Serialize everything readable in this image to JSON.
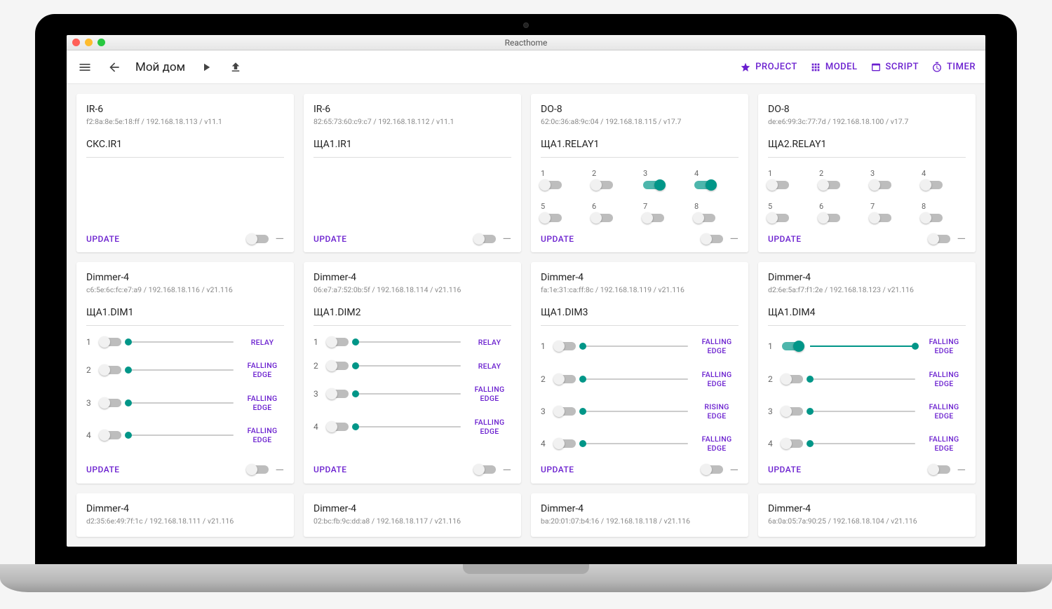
{
  "window": {
    "title": "Reacthome"
  },
  "header": {
    "title": "Мой дом",
    "tabs": [
      {
        "key": "project",
        "label": "PROJECT"
      },
      {
        "key": "model",
        "label": "MODEL"
      },
      {
        "key": "script",
        "label": "SCRIPT"
      },
      {
        "key": "timer",
        "label": "TIMER"
      }
    ]
  },
  "labels": {
    "update": "UPDATE"
  },
  "modes": {
    "relay": "RELAY",
    "falling": "FALLING EDGE",
    "rising": "RISING EDGE"
  },
  "cards": [
    {
      "type": "ir",
      "title": "IR-6",
      "sub": "f2:8a:8e:5e:18:ff / 192.168.18.113 / v11.1",
      "name": "СКС.IR1"
    },
    {
      "type": "ir",
      "title": "IR-6",
      "sub": "82:65:73:60:c9:c7 / 192.168.18.112 / v11.1",
      "name": "ЩА1.IR1"
    },
    {
      "type": "relay",
      "title": "DO-8",
      "sub": "62:0c:36:a8:9c:04 / 192.168.18.115 / v17.7",
      "name": "ЩА1.RELAY1",
      "channels": [
        {
          "n": "1",
          "on": false
        },
        {
          "n": "2",
          "on": false
        },
        {
          "n": "3",
          "on": true
        },
        {
          "n": "4",
          "on": true
        },
        {
          "n": "5",
          "on": false
        },
        {
          "n": "6",
          "on": false
        },
        {
          "n": "7",
          "on": false
        },
        {
          "n": "8",
          "on": false
        }
      ]
    },
    {
      "type": "relay",
      "title": "DO-8",
      "sub": "de:e6:99:3c:77:7d / 192.168.18.100 / v17.7",
      "name": "ЩА2.RELAY1",
      "channels": [
        {
          "n": "1",
          "on": false
        },
        {
          "n": "2",
          "on": false
        },
        {
          "n": "3",
          "on": false
        },
        {
          "n": "4",
          "on": false
        },
        {
          "n": "5",
          "on": false
        },
        {
          "n": "6",
          "on": false
        },
        {
          "n": "7",
          "on": false
        },
        {
          "n": "8",
          "on": false
        }
      ]
    },
    {
      "type": "dimmer",
      "title": "Dimmer-4",
      "sub": "c6:5e:6c:fc:e7:a9 / 192.168.18.116 / v21.116",
      "name": "ЩА1.DIM1",
      "channels": [
        {
          "n": "1",
          "on": false,
          "val": 0,
          "mode": "relay"
        },
        {
          "n": "2",
          "on": false,
          "val": 0,
          "mode": "falling"
        },
        {
          "n": "3",
          "on": false,
          "val": 0,
          "mode": "falling"
        },
        {
          "n": "4",
          "on": false,
          "val": 0,
          "mode": "falling"
        }
      ]
    },
    {
      "type": "dimmer",
      "title": "Dimmer-4",
      "sub": "06:e7:a7:52:0b:5f / 192.168.18.114 / v21.116",
      "name": "ЩА1.DIM2",
      "channels": [
        {
          "n": "1",
          "on": false,
          "val": 0,
          "mode": "relay"
        },
        {
          "n": "2",
          "on": false,
          "val": 0,
          "mode": "relay"
        },
        {
          "n": "3",
          "on": false,
          "val": 0,
          "mode": "falling"
        },
        {
          "n": "4",
          "on": false,
          "val": 0,
          "mode": "falling"
        }
      ]
    },
    {
      "type": "dimmer",
      "title": "Dimmer-4",
      "sub": "fa:1e:31:ca:ff:8c / 192.168.18.119 / v21.116",
      "name": "ЩА1.DIM3",
      "channels": [
        {
          "n": "1",
          "on": false,
          "val": 0,
          "mode": "falling"
        },
        {
          "n": "2",
          "on": false,
          "val": 0,
          "mode": "falling"
        },
        {
          "n": "3",
          "on": false,
          "val": 0,
          "mode": "rising"
        },
        {
          "n": "4",
          "on": false,
          "val": 0,
          "mode": "falling"
        }
      ]
    },
    {
      "type": "dimmer",
      "title": "Dimmer-4",
      "sub": "d2:6e:5a:f7:f1:2e / 192.168.18.123 / v21.116",
      "name": "ЩА1.DIM4",
      "channels": [
        {
          "n": "1",
          "on": true,
          "val": 100,
          "mode": "falling"
        },
        {
          "n": "2",
          "on": false,
          "val": 0,
          "mode": "falling"
        },
        {
          "n": "3",
          "on": false,
          "val": 0,
          "mode": "falling"
        },
        {
          "n": "4",
          "on": false,
          "val": 0,
          "mode": "falling"
        }
      ]
    },
    {
      "type": "stub",
      "title": "Dimmer-4",
      "sub": "d2:35:6e:49:7f:1c / 192.168.18.111 / v21.116"
    },
    {
      "type": "stub",
      "title": "Dimmer-4",
      "sub": "02:bc:fb:9c:dd:a8 / 192.168.18.117 / v21.116"
    },
    {
      "type": "stub",
      "title": "Dimmer-4",
      "sub": "ba:20:01:07:b4:16 / 192.168.18.118 / v21.116"
    },
    {
      "type": "stub",
      "title": "Dimmer-4",
      "sub": "6a:0a:05:7a:90:25 / 192.168.18.104 / v21.116"
    }
  ]
}
